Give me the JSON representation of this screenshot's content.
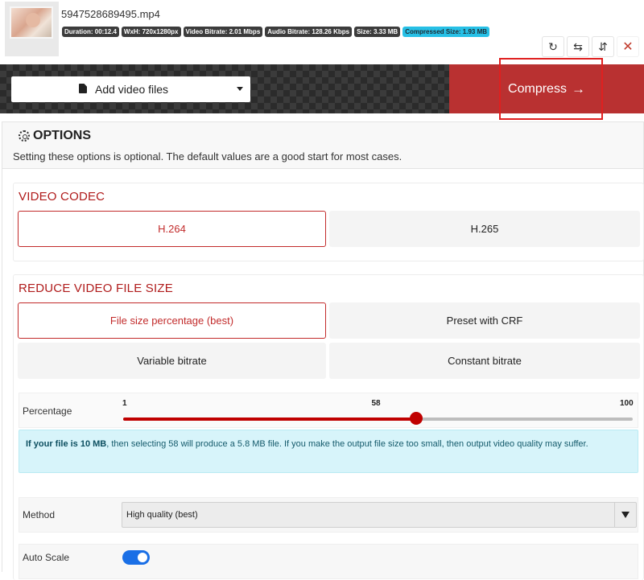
{
  "file": {
    "name": "5947528689495.mp4",
    "badges": {
      "duration": "Duration: 00:12.4",
      "dimensions": "WxH: 720x1280px",
      "video_bitrate": "Video Bitrate: 2.01 Mbps",
      "audio_bitrate": "Audio Bitrate: 128.26 Kbps",
      "size": "Size: 3.33 MB",
      "compressed_size": "Compressed Size: 1.93 MB"
    },
    "actions": {
      "rotate": "↻",
      "swap": "⇆",
      "flip": "⇵",
      "close": "✕"
    }
  },
  "toolbar": {
    "add_label": "Add video files",
    "compress_label": "Compress",
    "compress_arrow": "→"
  },
  "options": {
    "title": "OPTIONS",
    "description": "Setting these options is optional. The default values are a good start for most cases.",
    "video_codec": {
      "title": "VIDEO CODEC",
      "choices": [
        "H.264",
        "H.265"
      ],
      "selected": "H.264"
    },
    "reduce": {
      "title": "REDUCE VIDEO FILE SIZE",
      "choices": [
        "File size percentage (best)",
        "Preset with CRF",
        "Variable bitrate",
        "Constant bitrate"
      ],
      "selected": "File size percentage (best)",
      "percentage": {
        "label": "Percentage",
        "min": "1",
        "value": "58",
        "max": "100",
        "value_num": 58
      },
      "info_bold": "If your file is 10 MB",
      "info_rest": ", then selecting 58 will produce a 5.8 MB file. If you make the output file size too small, then output video quality may suffer.",
      "method": {
        "label": "Method",
        "value": "High quality (best)"
      },
      "auto_scale": {
        "label": "Auto Scale",
        "on": true
      }
    }
  },
  "colors": {
    "accent_red": "#b93131",
    "selected_outline": "#c22b2b",
    "info_bg": "#d7f4fa",
    "toggle_blue": "#1a6fe6"
  }
}
